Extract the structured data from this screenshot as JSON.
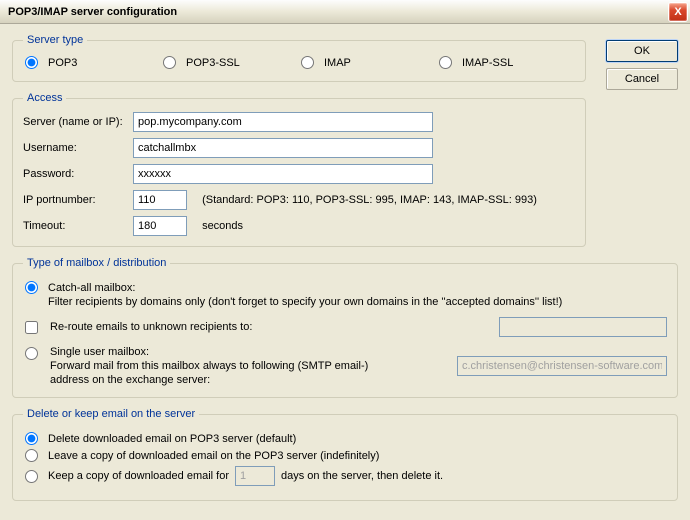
{
  "window": {
    "title": "POP3/IMAP server configuration",
    "close_symbol": "X"
  },
  "buttons": {
    "ok": "OK",
    "cancel": "Cancel"
  },
  "server_type": {
    "legend": "Server type",
    "options": {
      "pop3": "POP3",
      "pop3ssl": "POP3-SSL",
      "imap": "IMAP",
      "imapssl": "IMAP-SSL"
    },
    "selected": "pop3"
  },
  "access": {
    "legend": "Access",
    "server_label": "Server (name or IP):",
    "server_value": "pop.mycompany.com",
    "username_label": "Username:",
    "username_value": "catchallmbx",
    "password_label": "Password:",
    "password_value": "xxxxxx",
    "port_label": "IP portnumber:",
    "port_value": "110",
    "port_hint": "(Standard: POP3: 110, POP3-SSL: 995, IMAP: 143, IMAP-SSL: 993)",
    "timeout_label": "Timeout:",
    "timeout_value": "180",
    "timeout_unit": "seconds"
  },
  "mailbox": {
    "legend": "Type of mailbox / distribution",
    "catchall_title": "Catch-all mailbox:",
    "catchall_desc": "Filter recipients by domains only (don't forget to specify your own domains in the ''accepted domains'' list!)",
    "reroute_label": "Re-route emails to unknown recipients to:",
    "reroute_value": "",
    "single_title": "Single user mailbox:",
    "single_desc": "Forward mail from this mailbox always to following (SMTP email-) address on the exchange server:",
    "single_value": "c.christensen@christensen-software.com",
    "selected": "catchall"
  },
  "delete": {
    "legend": "Delete or keep email on the server",
    "opt_delete": "Delete downloaded email on POP3 server (default)",
    "opt_leave": "Leave a copy of downloaded email on the POP3 server (indefinitely)",
    "opt_keep_prefix": "Keep a copy of downloaded email for",
    "opt_keep_suffix": "days on the server, then delete it.",
    "days_value": "1",
    "selected": "delete"
  }
}
